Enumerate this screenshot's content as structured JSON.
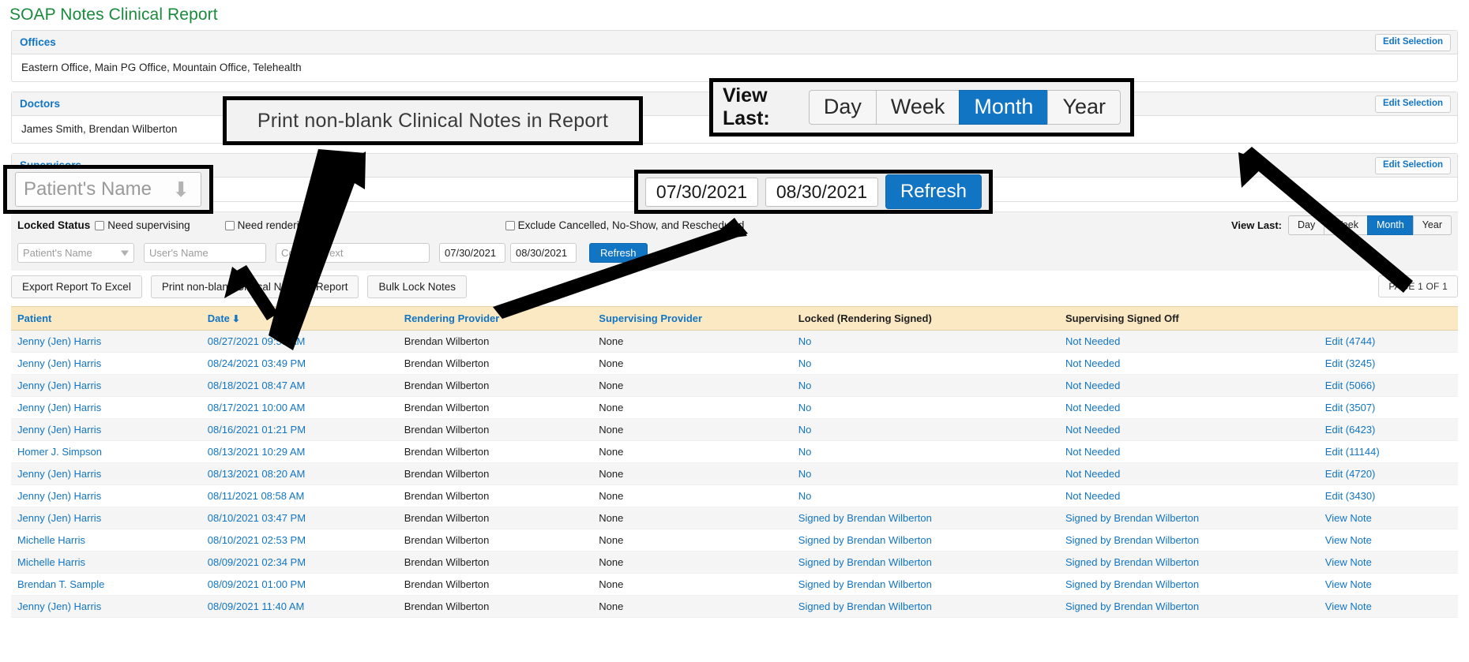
{
  "page": {
    "title": "SOAP Notes Clinical Report",
    "title_color": "#1a8a3c",
    "accent_color": "#1275c4",
    "header_bg": "#fbe9c4"
  },
  "panels": [
    {
      "heading": "Offices",
      "value": "Eastern Office, Main PG Office, Mountain Office, Telehealth",
      "edit_label": "Edit Selection"
    },
    {
      "heading": "Doctors",
      "value": "James Smith, Brendan Wilberton",
      "edit_label": "Edit Selection"
    },
    {
      "heading": "Supervisors",
      "value": "",
      "edit_label": "Edit Selection"
    }
  ],
  "filters": {
    "locked_status_label": "Locked Status",
    "need_supervising_label": "Need supervising",
    "need_supervising_checked": false,
    "need_rendering_label": "Need rendering",
    "need_rendering_checked": false,
    "exclude_label": "Exclude Cancelled, No-Show, and Rescheduled",
    "exclude_checked": false,
    "patient_name_placeholder": "Patient's Name",
    "patient_name_value": "",
    "user_name_placeholder": "User's Name",
    "user_name_value": "",
    "contains_text_placeholder": "Contains Text",
    "contains_text_value": "",
    "date_from": "07/30/2021",
    "date_to": "08/30/2021",
    "refresh_label": "Refresh"
  },
  "view_last": {
    "label": "View Last:",
    "options": [
      "Day",
      "Week",
      "Month",
      "Year"
    ],
    "selected": "Month"
  },
  "actions": {
    "export_label": "Export Report To Excel",
    "print_label": "Print non-blank Clinical Notes in Report",
    "bulk_lock_label": "Bulk Lock Notes",
    "page_indicator": "PAGE 1 OF 1"
  },
  "table": {
    "columns": [
      "Patient",
      "Date",
      "Rendering Provider",
      "Supervising Provider",
      "Locked (Rendering Signed)",
      "Supervising Signed Off",
      ""
    ],
    "sort_column": "Date",
    "sort_direction": "down",
    "rows": [
      {
        "patient": "Jenny (Jen) Harris",
        "date": "08/27/2021 09:53 AM",
        "rendering": "Brendan Wilberton",
        "supervising": "None",
        "locked": "No",
        "signed_off": "Not Needed",
        "action": "Edit (4744)"
      },
      {
        "patient": "Jenny (Jen) Harris",
        "date": "08/24/2021 03:49 PM",
        "rendering": "Brendan Wilberton",
        "supervising": "None",
        "locked": "No",
        "signed_off": "Not Needed",
        "action": "Edit (3245)"
      },
      {
        "patient": "Jenny (Jen) Harris",
        "date": "08/18/2021 08:47 AM",
        "rendering": "Brendan Wilberton",
        "supervising": "None",
        "locked": "No",
        "signed_off": "Not Needed",
        "action": "Edit (5066)"
      },
      {
        "patient": "Jenny (Jen) Harris",
        "date": "08/17/2021 10:00 AM",
        "rendering": "Brendan Wilberton",
        "supervising": "None",
        "locked": "No",
        "signed_off": "Not Needed",
        "action": "Edit (3507)"
      },
      {
        "patient": "Jenny (Jen) Harris",
        "date": "08/16/2021 01:21 PM",
        "rendering": "Brendan Wilberton",
        "supervising": "None",
        "locked": "No",
        "signed_off": "Not Needed",
        "action": "Edit (6423)"
      },
      {
        "patient": "Homer J. Simpson",
        "date": "08/13/2021 10:29 AM",
        "rendering": "Brendan Wilberton",
        "supervising": "None",
        "locked": "No",
        "signed_off": "Not Needed",
        "action": "Edit (11144)"
      },
      {
        "patient": "Jenny (Jen) Harris",
        "date": "08/13/2021 08:20 AM",
        "rendering": "Brendan Wilberton",
        "supervising": "None",
        "locked": "No",
        "signed_off": "Not Needed",
        "action": "Edit (4720)"
      },
      {
        "patient": "Jenny (Jen) Harris",
        "date": "08/11/2021 08:58 AM",
        "rendering": "Brendan Wilberton",
        "supervising": "None",
        "locked": "No",
        "signed_off": "Not Needed",
        "action": "Edit (3430)"
      },
      {
        "patient": "Jenny (Jen) Harris",
        "date": "08/10/2021 03:47 PM",
        "rendering": "Brendan Wilberton",
        "supervising": "None",
        "locked": "Signed by Brendan Wilberton",
        "signed_off": "Signed by Brendan Wilberton",
        "action": "View Note"
      },
      {
        "patient": "Michelle Harris",
        "date": "08/10/2021 02:53 PM",
        "rendering": "Brendan Wilberton",
        "supervising": "None",
        "locked": "Signed by Brendan Wilberton",
        "signed_off": "Signed by Brendan Wilberton",
        "action": "View Note"
      },
      {
        "patient": "Michelle Harris",
        "date": "08/09/2021 02:34 PM",
        "rendering": "Brendan Wilberton",
        "supervising": "None",
        "locked": "Signed by Brendan Wilberton",
        "signed_off": "Signed by Brendan Wilberton",
        "action": "View Note"
      },
      {
        "patient": "Brendan T. Sample",
        "date": "08/09/2021 01:00 PM",
        "rendering": "Brendan Wilberton",
        "supervising": "None",
        "locked": "Signed by Brendan Wilberton",
        "signed_off": "Signed by Brendan Wilberton",
        "action": "View Note"
      },
      {
        "patient": "Jenny (Jen) Harris",
        "date": "08/09/2021 11:40 AM",
        "rendering": "Brendan Wilberton",
        "supervising": "None",
        "locked": "Signed by Brendan Wilberton",
        "signed_off": "Signed by Brendan Wilberton",
        "action": "View Note"
      }
    ]
  },
  "annotations": {
    "print_callout_text": "Print non-blank Clinical Notes in Report",
    "viewlast_callout_label": "View Last:",
    "viewlast_callout_options": [
      "Day",
      "Week",
      "Month",
      "Year"
    ],
    "viewlast_callout_selected": "Month",
    "select_callout_text": "Patient's Name",
    "dates_callout_from": "07/30/2021",
    "dates_callout_to": "08/30/2021",
    "dates_callout_refresh": "Refresh"
  }
}
